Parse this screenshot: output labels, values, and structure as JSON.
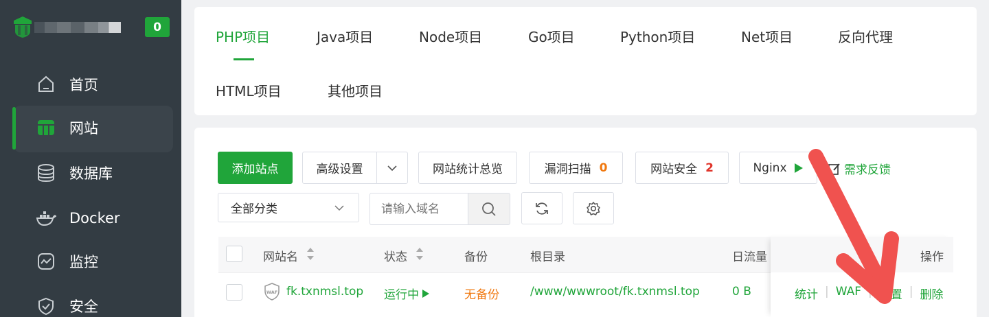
{
  "sidebar": {
    "badge": "0",
    "items": [
      {
        "label": "首页",
        "icon": "home-icon"
      },
      {
        "label": "网站",
        "icon": "website-icon"
      },
      {
        "label": "数据库",
        "icon": "database-icon"
      },
      {
        "label": "Docker",
        "icon": "docker-icon"
      },
      {
        "label": "监控",
        "icon": "monitor-icon"
      },
      {
        "label": "安全",
        "icon": "shield-icon"
      }
    ]
  },
  "tabs": [
    "PHP项目",
    "Java项目",
    "Node项目",
    "Go项目",
    "Python项目",
    "Net项目",
    "反向代理",
    "HTML项目",
    "其他项目"
  ],
  "toolbar": {
    "add_site": "添加站点",
    "advanced": "高级设置",
    "stats_overview": "网站统计总览",
    "vuln_scan": "漏洞扫描",
    "vuln_count": "0",
    "site_security": "网站安全",
    "security_count": "2",
    "nginx": "Nginx",
    "feedback": "需求反馈",
    "category": "全部分类",
    "search_placeholder": "请输入域名"
  },
  "table": {
    "headers": {
      "name": "网站名",
      "status": "状态",
      "backup": "备份",
      "root": "根目录",
      "traffic": "日流量",
      "ops": "操作"
    },
    "rows": [
      {
        "waf_icon_text": "WAF",
        "name": "fk.txnmsl.top",
        "status": "运行中",
        "backup": "无备份",
        "root": "/www/wwwroot/fk.txnmsl.top",
        "traffic": "0 B",
        "ops": [
          "统计",
          "WAF",
          "设置",
          "删除"
        ]
      }
    ]
  },
  "colors": {
    "accent": "#20a53a",
    "sidebar_bg": "#333c43",
    "warning": "#f0780f",
    "danger": "#e0352b",
    "annotation_arrow": "#f0524f"
  }
}
